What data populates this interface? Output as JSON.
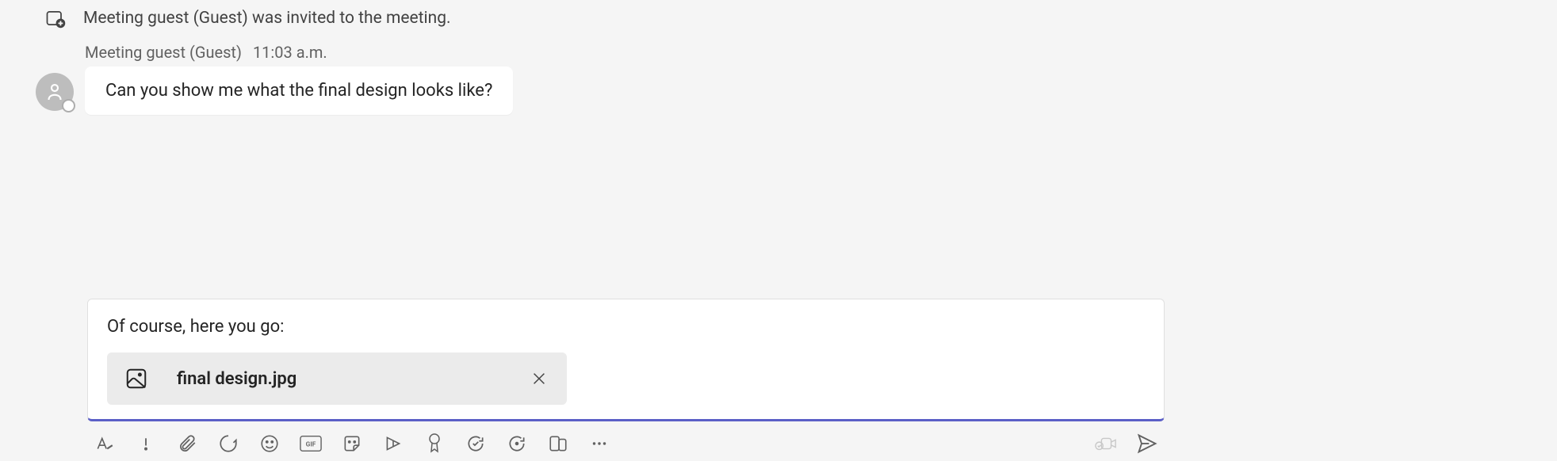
{
  "system_event": {
    "text": "Meeting guest (Guest) was invited to the meeting."
  },
  "message": {
    "sender": "Meeting guest (Guest)",
    "timestamp": "11:03 a.m.",
    "text": "Can you show me what the final design looks like?"
  },
  "composer": {
    "text": "Of course, here you go:",
    "attachment": {
      "name": "final design.jpg"
    }
  }
}
